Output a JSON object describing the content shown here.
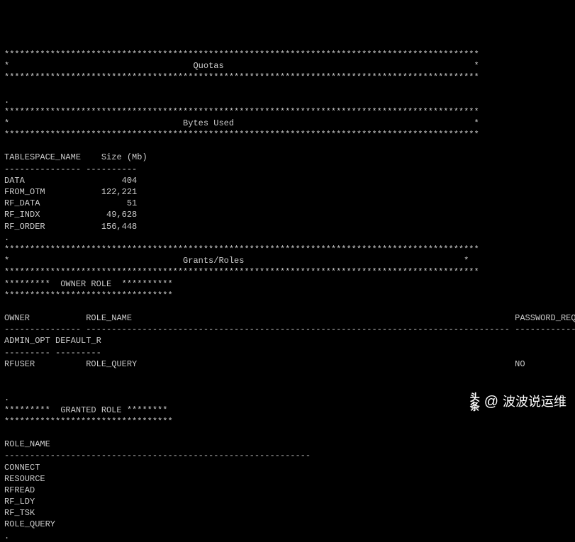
{
  "sections": {
    "quotas_title": "Quotas",
    "bytes_used_title": "Bytes Used",
    "grants_roles_title": "Grants/Roles",
    "owner_role_label": "OWNER ROLE",
    "granted_role_label": "GRANTED ROLE"
  },
  "bytes_used": {
    "col1": "TABLESPACE_NAME",
    "col2": "Size (Mb)",
    "rows": [
      {
        "name": "DATA",
        "size": "404"
      },
      {
        "name": "FROM_OTM",
        "size": "122,221"
      },
      {
        "name": "RF_DATA",
        "size": "51"
      },
      {
        "name": "RF_INDX",
        "size": "49,628"
      },
      {
        "name": "RF_ORDER",
        "size": "156,448"
      }
    ]
  },
  "owner_role": {
    "col1": "OWNER",
    "col2": "ROLE_NAME",
    "col3": "PASSWORD_REQUIRED",
    "sub1": "ADMIN_OPT",
    "sub2": "DEFAULT_R",
    "row": {
      "owner": "RFUSER",
      "role": "ROLE_QUERY",
      "pwd": "NO"
    }
  },
  "granted_role": {
    "col1": "ROLE_NAME",
    "items": [
      "CONNECT",
      "RESOURCE",
      "RFREAD",
      "RF_LDY",
      "RF_TSK",
      "ROLE_QUERY"
    ]
  },
  "watermark": {
    "brand_top": "头",
    "brand_bottom": "条",
    "at": "@",
    "name": "波波说运维"
  }
}
